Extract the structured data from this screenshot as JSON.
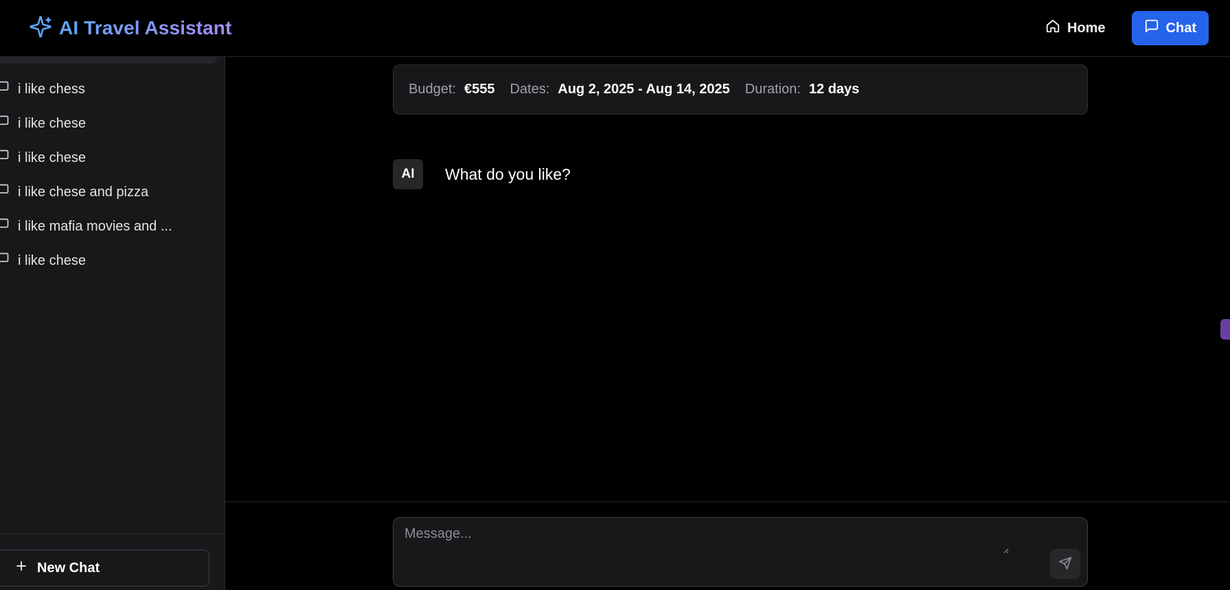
{
  "header": {
    "title": "AI Travel Assistant",
    "brand_icon": "sparkles-icon",
    "nav": {
      "home_label": "Home",
      "chat_label": "Chat"
    }
  },
  "sidebar": {
    "conversations": [
      {
        "label": "i like chess",
        "icon": "message-square-icon"
      },
      {
        "label": "i like chese",
        "icon": "message-square-icon"
      },
      {
        "label": "i like chese",
        "icon": "message-square-icon"
      },
      {
        "label": "i like chese and pizza",
        "icon": "message-square-icon"
      },
      {
        "label": "i like mafia movies and ...",
        "icon": "message-square-icon"
      },
      {
        "label": "i like chese",
        "icon": "message-square-icon"
      }
    ],
    "new_chat_label": "New Chat"
  },
  "trip": {
    "budget_label": "Budget:",
    "budget_value": "€555",
    "dates_label": "Dates:",
    "dates_value": "Aug 2, 2025 - Aug 14, 2025",
    "duration_label": "Duration:",
    "duration_value": "12 days"
  },
  "messages": [
    {
      "avatar": "AI",
      "text": "What do you like?"
    }
  ],
  "composer": {
    "placeholder": "Message...",
    "value": ""
  },
  "colors": {
    "accent": "#2563eb",
    "brand_gradient_start": "#60a5fa",
    "brand_gradient_end": "#a78bfa",
    "background": "#000000",
    "sidebar_bg": "#18181b"
  }
}
